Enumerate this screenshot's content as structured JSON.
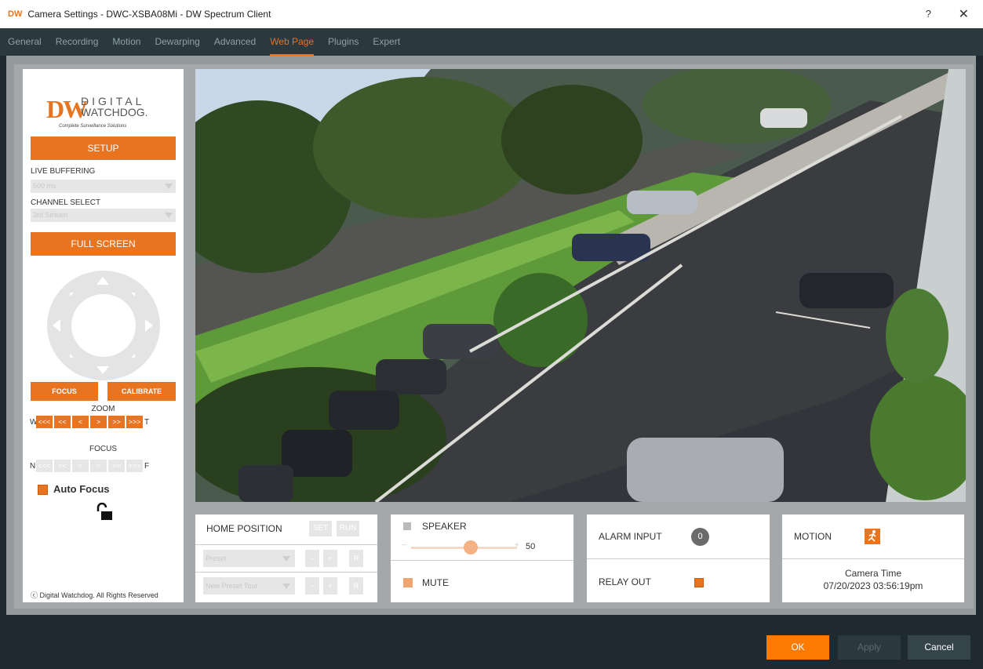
{
  "window": {
    "logo": "DW",
    "title": "Camera Settings - DWC-XSBA08Mi - DW Spectrum Client",
    "help": "?",
    "close": "✕"
  },
  "tabs": [
    {
      "label": "General"
    },
    {
      "label": "Recording"
    },
    {
      "label": "Motion"
    },
    {
      "label": "Dewarping"
    },
    {
      "label": "Advanced"
    },
    {
      "label": "Web Page",
      "active": true
    },
    {
      "label": "Plugins"
    },
    {
      "label": "Expert"
    }
  ],
  "brand": {
    "mark": "DW",
    "line1": "DIGITAL",
    "line2": "WATCHDOG.",
    "tagline": "Complete Surveillance Solutions"
  },
  "left": {
    "setup": "SETUP",
    "live_buffering_label": "LIVE BUFFERING",
    "live_buffering_value": "500 ms",
    "channel_label": "CHANNEL SELECT",
    "channel_value": "3rd Stream",
    "fullscreen": "FULL SCREEN",
    "focus_btn": "FOCUS",
    "calibrate_btn": "CALIBRATE",
    "zoom_label": "ZOOM",
    "zoom_w": "W",
    "zoom_t": "T",
    "zoom_buttons": [
      "<<<",
      "<<",
      "<",
      ">",
      ">>",
      ">>>"
    ],
    "focus_label": "FOCUS",
    "focus_n": "N",
    "focus_f": "F",
    "focus_buttons": [
      "<<<",
      "<<",
      "<",
      ">",
      ">>",
      ">>>"
    ],
    "auto_focus": "Auto Focus",
    "copyright": "ⓒ Digital Watchdog. All Rights Reserved"
  },
  "home": {
    "label": "HOME POSITION",
    "set": "SET",
    "run": "RUN",
    "preset": "Preset",
    "preset_tour": "New Preset Tour",
    "minus": "−",
    "plus": "+",
    "r": "R"
  },
  "audio": {
    "speaker": "SPEAKER",
    "minus": "−",
    "plus": "+",
    "volume": "50",
    "volume_fraction": 0.56,
    "mute": "MUTE"
  },
  "io": {
    "alarm_input": "ALARM INPUT",
    "alarm_value": "0",
    "relay_out": "RELAY OUT"
  },
  "motion": {
    "label": "MOTION",
    "camera_time_label": "Camera Time",
    "camera_time": "07/20/2023 03:56:19pm"
  },
  "footer": {
    "ok": "OK",
    "apply": "Apply",
    "cancel": "Cancel"
  },
  "colors": {
    "accent": "#e8741f",
    "dark_bg": "#1e2a30",
    "tab_bg": "#2b383e"
  }
}
